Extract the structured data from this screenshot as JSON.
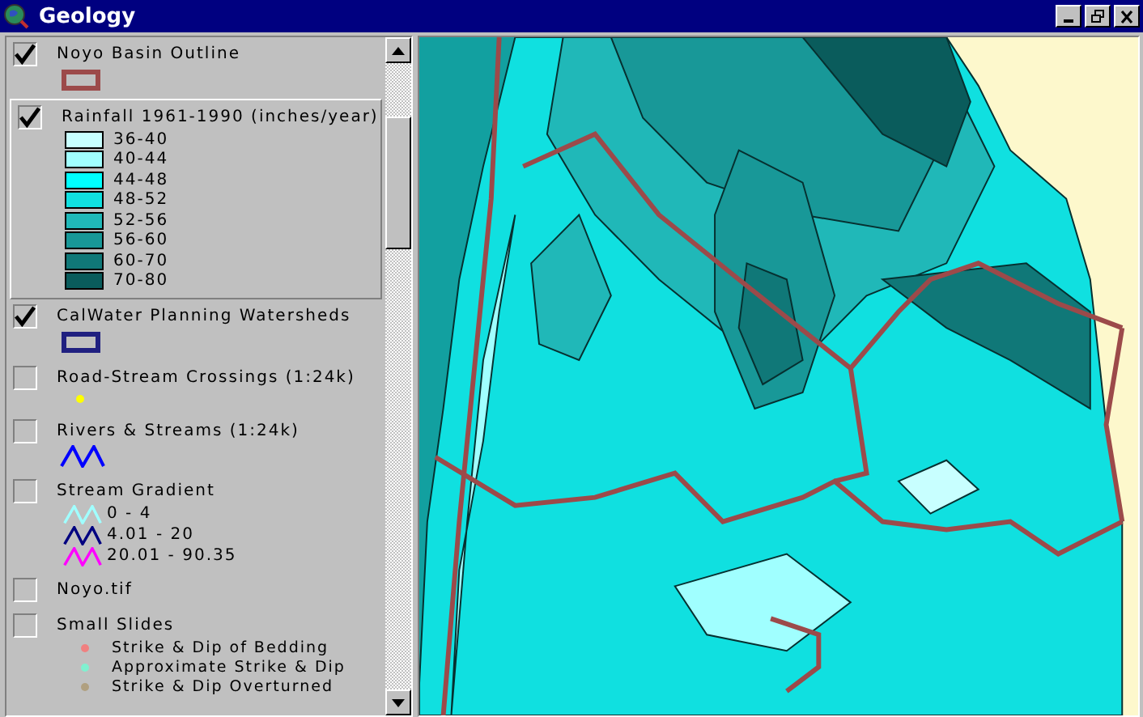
{
  "window": {
    "title": "Geology"
  },
  "layers": [
    {
      "kind": "outline",
      "label": "Noyo Basin Outline",
      "checked": true,
      "selected": false,
      "color": "#9c4a4a"
    },
    {
      "kind": "classes",
      "label": "Rainfall 1961-1990 (inches/year)",
      "checked": true,
      "selected": true,
      "classes": [
        {
          "label": "36-40",
          "color": "#c8ffff"
        },
        {
          "label": "40-44",
          "color": "#a0ffff"
        },
        {
          "label": "44-48",
          "color": "#00ffff"
        },
        {
          "label": "48-52",
          "color": "#10e0e0"
        },
        {
          "label": "52-56",
          "color": "#20b8b8"
        },
        {
          "label": "56-60",
          "color": "#189898"
        },
        {
          "label": "60-70",
          "color": "#107878"
        },
        {
          "label": "70-80",
          "color": "#0a5c5c"
        }
      ]
    },
    {
      "kind": "outline",
      "label": "CalWater Planning Watersheds",
      "checked": true,
      "selected": false,
      "color": "#202080"
    },
    {
      "kind": "point",
      "label": "Road-Stream Crossings (1:24k)",
      "checked": false,
      "selected": false,
      "color": "#ffff00"
    },
    {
      "kind": "line",
      "label": "Rivers & Streams (1:24k)",
      "checked": false,
      "selected": false,
      "color": "#0000ff"
    },
    {
      "kind": "gradient",
      "label": "Stream Gradient",
      "checked": false,
      "selected": false,
      "classes": [
        {
          "label": "0 - 4",
          "color": "#a0ffff"
        },
        {
          "label": "4.01 - 20",
          "color": "#000080"
        },
        {
          "label": "20.01 - 90.35",
          "color": "#ff00ff"
        }
      ]
    },
    {
      "kind": "plain",
      "label": "Noyo.tif",
      "checked": false,
      "selected": false
    },
    {
      "kind": "points",
      "label": "Small Slides",
      "checked": false,
      "selected": false,
      "classes": [
        {
          "label": "Strike & Dip of Bedding",
          "color": "#f08080"
        },
        {
          "label": "Approximate Strike & Dip",
          "color": "#80f0d0"
        },
        {
          "label": "Strike & Dip Overturned",
          "color": "#b0a080"
        }
      ]
    }
  ]
}
